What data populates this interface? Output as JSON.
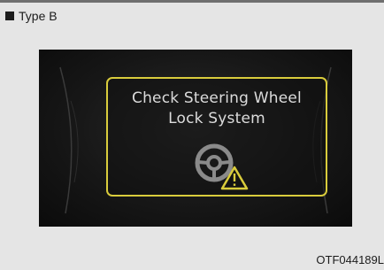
{
  "heading": {
    "bullet_icon": "square-bullet",
    "label": "Type B"
  },
  "display": {
    "background": "#121212",
    "panel": {
      "border_color": "#d9cc3c",
      "text_color": "#dcdcdc",
      "message_line1": "Check Steering Wheel",
      "message_line2": "Lock System",
      "icons": [
        "steering-wheel-icon",
        "warning-triangle-icon"
      ]
    }
  },
  "figure_code": "OTF044189L"
}
